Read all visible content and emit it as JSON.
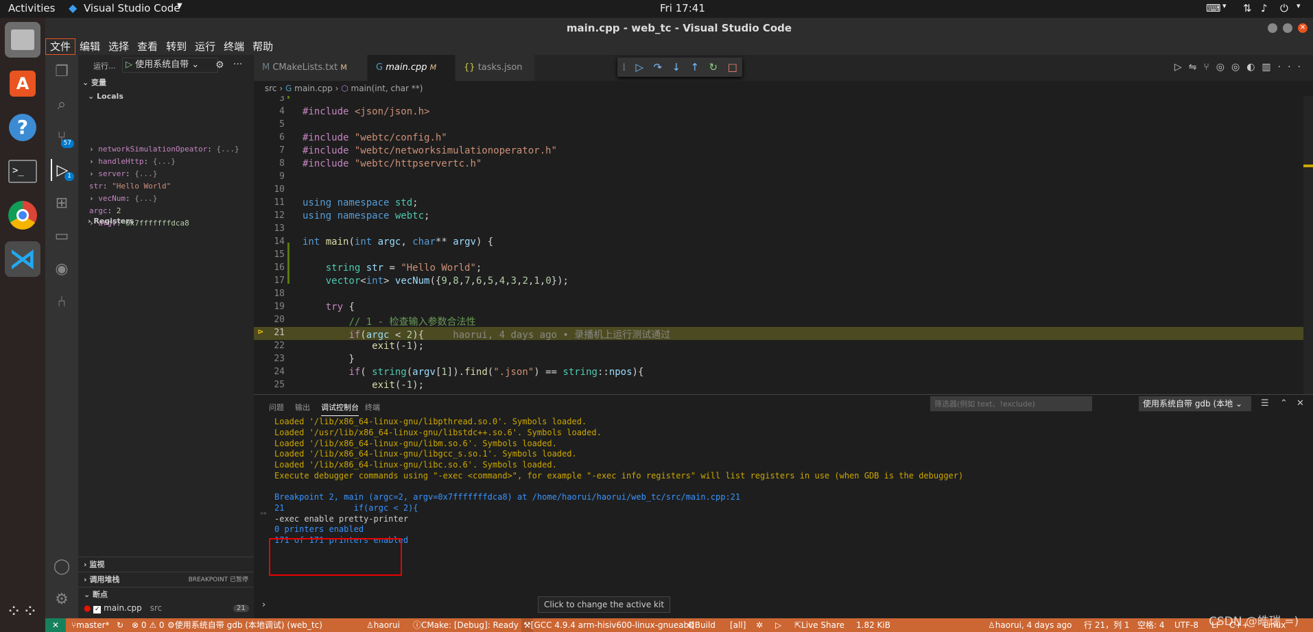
{
  "topbar": {
    "activities": "Activities",
    "app": "Visual Studio Code",
    "clock": "Fri 17:41"
  },
  "window": {
    "title": "main.cpp - web_tc - Visual Studio Code"
  },
  "menu": [
    "文件",
    "编辑",
    "选择",
    "查看",
    "转到",
    "运行",
    "终端",
    "帮助"
  ],
  "activity": {
    "scm_badge": "57",
    "debug_badge": "1"
  },
  "sidebar": {
    "run_label": "运行...",
    "config": "使用系统自带",
    "variables_header": "变量",
    "locals_header": "Locals",
    "locals": [
      {
        "name": "networkSimulationOpeator",
        "value": "{...}",
        "expandable": true
      },
      {
        "name": "handleHttp",
        "value": "{...}",
        "expandable": true
      },
      {
        "name": "server",
        "value": "{...}",
        "expandable": true
      },
      {
        "name": "str",
        "value": "\"Hello World\"",
        "expandable": false
      },
      {
        "name": "vecNum",
        "value": "{...}",
        "expandable": true
      },
      {
        "name": "argc",
        "value": "2",
        "expandable": false
      },
      {
        "name": "argv",
        "value": "0x7fffffffdca8",
        "expandable": true
      }
    ],
    "registers": "Registers",
    "watch": "监视",
    "callstack": "调用堆栈",
    "callstack_status": "BREAKPOINT 已暂停",
    "breakpoints": "断点",
    "bp_file": "main.cpp",
    "bp_folder": "src",
    "bp_line": "21"
  },
  "tabs": [
    {
      "label": "CMakeLists.txt",
      "mark": "M",
      "icon": "M"
    },
    {
      "label": "main.cpp",
      "mark": "M",
      "icon": "G"
    },
    {
      "label": "tasks.json",
      "mark": "",
      "icon": "{}"
    }
  ],
  "breadcrumb": {
    "folder": "src",
    "file": "main.cpp",
    "symbol": "main(int, char **)"
  },
  "editor": {
    "line_numbers": [
      "3",
      "4",
      "5",
      "6",
      "7",
      "8",
      "9",
      "10",
      "11",
      "12",
      "13",
      "14",
      "15",
      "16",
      "17",
      "18",
      "19",
      "20",
      "21",
      "22",
      "23",
      "24",
      "25"
    ],
    "blame": "haorui, 4 days ago • 录播机上运行测试通过"
  },
  "panel": {
    "tabs": [
      "问题",
      "输出",
      "调试控制台",
      "终端"
    ],
    "filter_placeholder": "筛选器(例如 text、!exclude)",
    "session": "使用系统自带 gdb (本地",
    "lines": [
      "Loaded '/lib/x86_64-linux-gnu/libpthread.so.0'. Symbols loaded.",
      "Loaded '/usr/lib/x86_64-linux-gnu/libstdc++.so.6'. Symbols loaded.",
      "Loaded '/lib/x86_64-linux-gnu/libm.so.6'. Symbols loaded.",
      "Loaded '/lib/x86_64-linux-gnu/libgcc_s.so.1'. Symbols loaded.",
      "Loaded '/lib/x86_64-linux-gnu/libc.so.6'. Symbols loaded.",
      "Execute debugger commands using \"-exec <command>\", for example \"-exec info registers\" will list registers in use (when GDB is the debugger)",
      "Breakpoint 2, main (argc=2, argv=0x7fffffffdca8) at /home/haorui/haorui/web_tc/src/main.cpp:21",
      "21              if(argc < 2){",
      "-exec enable pretty-printer",
      "0 printers enabled",
      "171 of 171 printers enabled"
    ]
  },
  "tooltip": "Click to change the active kit",
  "status": {
    "branch": "master*",
    "problems": "⊗ 0 ⚠ 0",
    "debug": "使用系统自带 gdb (本地调试) (web_tc)",
    "user": "haorui",
    "cmake": "CMake: [Debug]: Ready",
    "kit": "[GCC 4.9.4 arm-hisiv600-linux-gnueabi]",
    "build": "Build",
    "target": "[all]",
    "liveshare": "Live Share",
    "size": "1.82 KiB",
    "blame": "haorui, 4 days ago",
    "position": "行 21，列 1",
    "spaces": "空格: 4",
    "encoding": "UTF-8",
    "eol": "LF",
    "lang": "C++",
    "os": "Linux"
  },
  "watermark": "CSDN @皓瑞 =)"
}
